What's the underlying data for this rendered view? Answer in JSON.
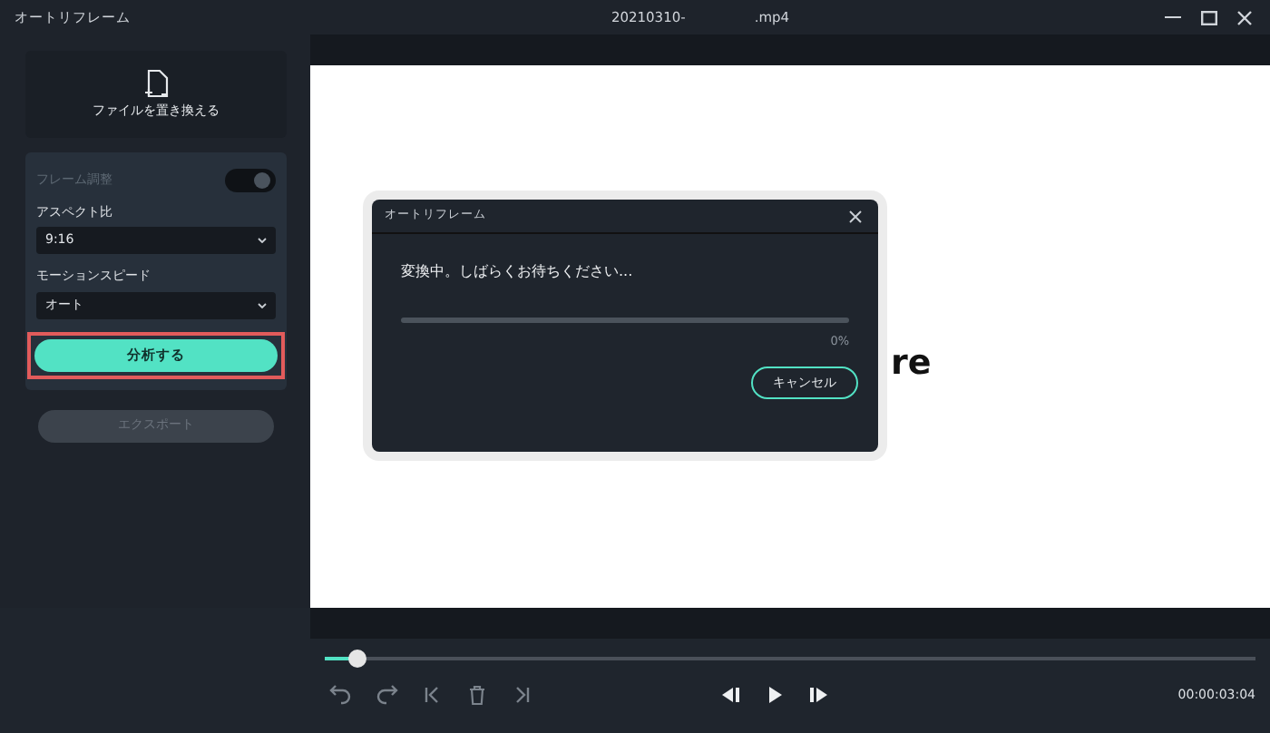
{
  "window": {
    "title": "オートリフレーム",
    "file_name_start": "20210310-",
    "file_name_end": ".mp4"
  },
  "sidebar": {
    "replace_file": "ファイルを置き換える",
    "frame_adjust": {
      "label": "フレーム調整",
      "on": true,
      "disabled": true
    },
    "aspect_ratio": {
      "label": "アスペクト比",
      "value": "9:16"
    },
    "motion_speed": {
      "label": "モーションスピード",
      "value": "オート"
    },
    "analyze_button": {
      "label": "分析する",
      "highlighted": true
    },
    "export_button": {
      "label": "エクスポート",
      "disabled": true
    }
  },
  "preview": {
    "text": "re"
  },
  "dialog": {
    "title": "オートリフレーム",
    "message": "変換中。しばらくお待ちください...",
    "level": 0,
    "percent": "0%",
    "cancel": "キャンセル"
  },
  "player": {
    "level": 0.035,
    "time": "00:00:03:04"
  }
}
